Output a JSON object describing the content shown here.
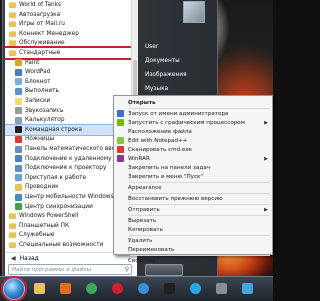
{
  "programs": {
    "items": [
      {
        "label": "World of Tanks",
        "kind": "folder"
      },
      {
        "label": "Автозагрузка",
        "kind": "folder"
      },
      {
        "label": "Игры от Mail.ru",
        "kind": "folder"
      },
      {
        "label": "Коннект Менеджер",
        "kind": "folder"
      },
      {
        "label": "Обслуживание",
        "kind": "folder"
      },
      {
        "label": "Стандартные",
        "kind": "folder",
        "highlighted": true
      },
      {
        "label": "Paint",
        "kind": "app",
        "color": "#e0a030"
      },
      {
        "label": "WordPad",
        "kind": "app",
        "color": "#4a78c8"
      },
      {
        "label": "Блокнот",
        "kind": "app",
        "color": "#7ab0e0"
      },
      {
        "label": "Выполнить",
        "kind": "app",
        "color": "#5a8fd0"
      },
      {
        "label": "Записки",
        "kind": "app",
        "color": "#f2dd6b"
      },
      {
        "label": "Звукозапись",
        "kind": "app",
        "color": "#9a9a9a"
      },
      {
        "label": "Калькулятор",
        "kind": "app",
        "color": "#8a9fb5"
      },
      {
        "label": "Командная строка",
        "kind": "app",
        "color": "#202020",
        "selected": true
      },
      {
        "label": "Ножницы",
        "kind": "app",
        "color": "#d83a3a"
      },
      {
        "label": "Панель математического ввода",
        "kind": "app",
        "color": "#6c8fbf"
      },
      {
        "label": "Подключение к удаленному раб...",
        "kind": "app",
        "color": "#4a7fc0"
      },
      {
        "label": "Подключение к проектору",
        "kind": "app",
        "color": "#5d8cc9"
      },
      {
        "label": "Приступая к работе",
        "kind": "app",
        "color": "#66a0d8"
      },
      {
        "label": "Проводник",
        "kind": "app",
        "color": "#e8c25a"
      },
      {
        "label": "Центр мобильности Windows",
        "kind": "app",
        "color": "#4f86c6"
      },
      {
        "label": "Центр синхронизации",
        "kind": "app",
        "color": "#3fa34d"
      },
      {
        "label": "Windows PowerShell",
        "kind": "folder"
      },
      {
        "label": "Планшетный ПК",
        "kind": "folder"
      },
      {
        "label": "Служебные",
        "kind": "folder"
      },
      {
        "label": "Специальные возможности",
        "kind": "folder"
      }
    ],
    "back_label": "Назад",
    "search_placeholder": "Найти программы и файлы"
  },
  "right_pane": {
    "items": [
      "User",
      "Документы",
      "Изображения",
      "Музыка"
    ]
  },
  "context_menu": {
    "items": [
      {
        "label": "Открыть",
        "bold": true,
        "icon_color": ""
      },
      {
        "label": "Запуск от имени администратора",
        "icon_color": "#3d6fc4"
      },
      {
        "label": "Запустить с графическим процессором",
        "icon_color": "#76b900",
        "submenu": true
      },
      {
        "label": "Расположение файла",
        "icon_color": ""
      },
      {
        "label": "Edit with Notepad++",
        "icon_color": "#8ac24a"
      },
      {
        "label": "Сканировать cmd.exe",
        "icon_color": "#d83a3a"
      },
      {
        "label": "WinRAR",
        "icon_color": "#8a3a8a",
        "submenu": true
      },
      {
        "label": "Закрепить на панели задач",
        "icon_color": ""
      },
      {
        "label": "Закрепить в меню \"Пуск\"",
        "icon_color": ""
      },
      {
        "label": "Appearance",
        "icon_color": ""
      },
      {
        "label": "Восстановить прежнюю версию",
        "icon_color": ""
      },
      {
        "label": "Отправить",
        "icon_color": "",
        "submenu": true
      },
      {
        "label": "Вырезать",
        "icon_color": ""
      },
      {
        "label": "Копировать",
        "icon_color": ""
      },
      {
        "label": "Удалить",
        "icon_color": ""
      },
      {
        "label": "Переименовать",
        "icon_color": ""
      },
      {
        "label": "Свойства",
        "icon_color": ""
      }
    ]
  },
  "taskbar": {
    "apps": [
      {
        "name": "explorer-icon",
        "color": "#e8c25a"
      },
      {
        "name": "media-player-icon",
        "color": "#e07020"
      },
      {
        "name": "chrome-icon",
        "color": "#3aa857"
      },
      {
        "name": "opera-icon",
        "color": "#d21f2f"
      },
      {
        "name": "zona-icon",
        "color": "#3a8fd6"
      },
      {
        "name": "cmd-icon",
        "color": "#202020"
      },
      {
        "name": "skype-icon",
        "color": "#2aa8e6"
      },
      {
        "name": "game-icon",
        "color": "#8a8f96"
      },
      {
        "name": "screenshot-icon",
        "color": "#4aa3df"
      }
    ]
  }
}
